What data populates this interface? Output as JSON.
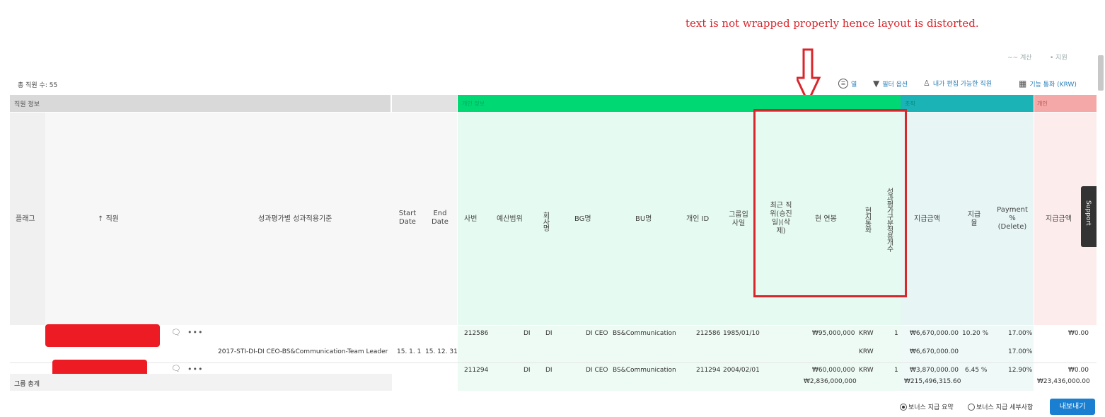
{
  "annotation": {
    "text": "text is not wrapped properly hence layout is distorted."
  },
  "top_links": {
    "left": "~~ 계산",
    "right": "• 지원"
  },
  "summary": {
    "employee_count": "총 직원 수: 55"
  },
  "toolbar": {
    "columns": "열",
    "filter": "필터 옵션",
    "editable": "내가 편집 가능한 직원",
    "currency": "기능 통화 (KRW)"
  },
  "groups": {
    "employee_info": "직원 정보",
    "personal_info": "개인 정보",
    "org": "조직",
    "individual": "개인"
  },
  "headers": {
    "flag": "플래그",
    "employee": "직원",
    "criteria": "성과평가별 성과적용기준",
    "start_date": "Start Date",
    "end_date": "End Date",
    "sabun": "사번",
    "budget": "예산범위",
    "company": "회사명",
    "bg": "BG명",
    "bu": "BU명",
    "personal_id": "개인 ID",
    "group_join": "그룹입사일",
    "recent_promo": "최근 직위(승진일)(삭제)",
    "current_salary": "현 연봉",
    "local_currency": "현지통화",
    "eval_count": "성과평가구분적용개수",
    "payment_amount": "지급금액",
    "payment_rate": "지급율",
    "payment_pct": "Payment % (Delete)",
    "individual_amount": "지급금액"
  },
  "rows": [
    {
      "sabun": "212586",
      "budget": "DI",
      "company": "DI",
      "bg": "DI CEO",
      "bu": "BS&Communication",
      "personal_id": "212586",
      "join_date": "1985/01/10",
      "salary": "₩95,000,000",
      "currency": "KRW",
      "count": "1",
      "amount": "₩6,670,000.00",
      "rate": "10.20 %",
      "pct": "17.00%",
      "ind_amount": "₩0.00",
      "detail": {
        "criteria": "2017-STI-DI-DI CEO-BS&Communication-Team Leader",
        "start": "15. 1. 1",
        "end": "15. 12. 31",
        "currency": "KRW",
        "amount": "₩6,670,000.00",
        "pct": "17.00%"
      }
    },
    {
      "sabun": "211294",
      "budget": "DI",
      "company": "DI",
      "bg": "DI CEO",
      "bu": "BS&Communication",
      "personal_id": "211294",
      "join_date": "2004/02/01",
      "salary": "₩60,000,000",
      "currency": "KRW",
      "count": "1",
      "amount": "₩3,870,000.00",
      "rate": "6.45 %",
      "pct": "12.90%",
      "ind_amount": "₩0.00"
    }
  ],
  "totals": {
    "label": "그룹 총계",
    "salary": "₩2,836,000,000",
    "amount": "₩215,496,315.60",
    "ind_amount": "₩23,436,000.00"
  },
  "footer": {
    "radio_summary": "보너스 지급 요약",
    "radio_detail": "보너스 지급 세부사항",
    "export": "내보내기"
  },
  "support_tab": "Support",
  "colors": {
    "green": "#00d973",
    "teal": "#1bb3b6",
    "pink": "#f4a9a8",
    "gray": "#d9d9d9",
    "accent": "#1a7fd0",
    "red": "#d9262c"
  }
}
